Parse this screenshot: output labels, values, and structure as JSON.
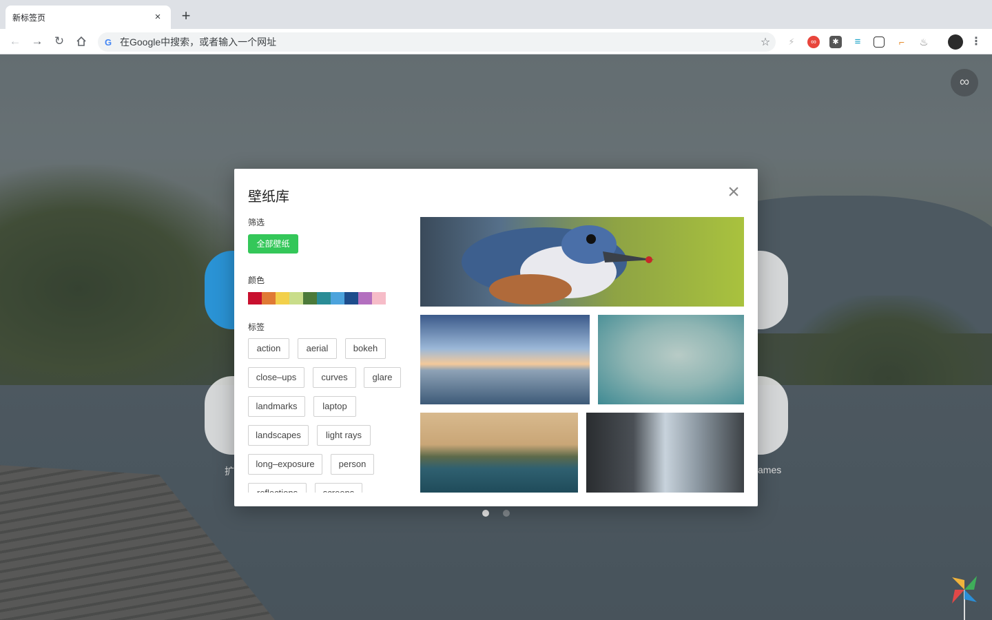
{
  "browser": {
    "tab_title": "新标签页",
    "tab_close": "×",
    "new_tab": "+",
    "omnibox_text": "在Google中搜索，或者输入一个网址",
    "google_letter": "G"
  },
  "extensions": [
    "bolt-icon",
    "infinity-icon",
    "asterisk-icon",
    "filter-icon",
    "image-icon",
    "paint-icon",
    "flame-icon",
    "avatar-icon",
    "menu-icon"
  ],
  "background": {
    "corner_icon": "∞",
    "shortcut_left_label": "扩",
    "shortcut_right_label": "ames"
  },
  "modal": {
    "title": "壁纸库",
    "close": "×",
    "filter_label": "筛选",
    "all_wallpapers": "全部壁纸",
    "color_label": "颜色",
    "colors": [
      "#c8102e",
      "#e07a35",
      "#f2d04b",
      "#c9dd8a",
      "#4c7a3a",
      "#2a8c96",
      "#4ca3dc",
      "#1e4d8c",
      "#b36fbf",
      "#f6bcc8"
    ],
    "tags_label": "标签",
    "tags": [
      "action",
      "aerial",
      "bokeh",
      "close–ups",
      "curves",
      "glare",
      "landmarks",
      "laptop",
      "landscapes",
      "light rays",
      "long–exposure",
      "person",
      "reflections",
      "screens"
    ]
  },
  "pagination": {
    "count": 2,
    "active": 0
  }
}
